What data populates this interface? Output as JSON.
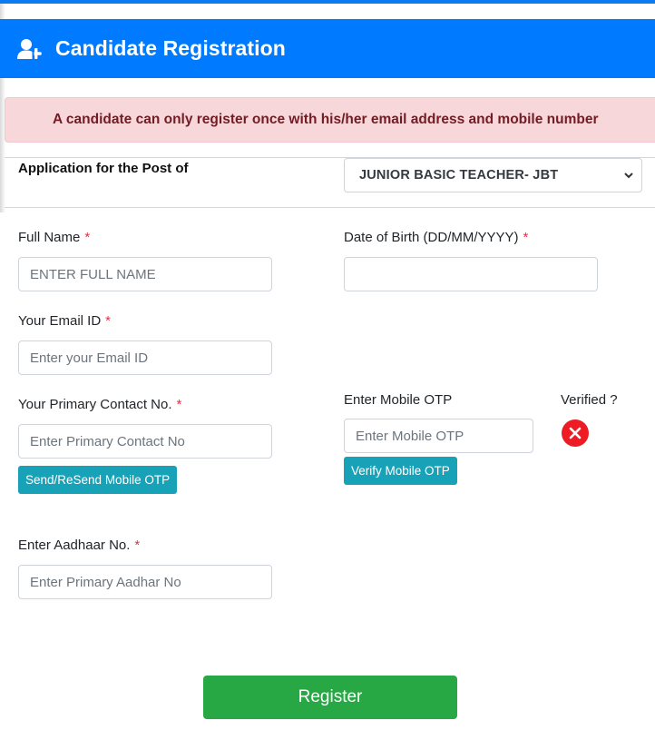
{
  "header": {
    "title": "Candidate Registration",
    "icon": "user-plus-icon",
    "color": "#007bff"
  },
  "alert": {
    "message": "A candidate can only register once with his/her email address and mobile number",
    "bg_color": "#f8d7da",
    "text_color": "#721c24"
  },
  "post": {
    "label": "Application for the Post of",
    "selected": "JUNIOR BASIC TEACHER- JBT"
  },
  "fields": {
    "full_name": {
      "label": "Full Name",
      "required": "*",
      "placeholder": "ENTER FULL NAME",
      "value": ""
    },
    "dob": {
      "label": "Date of Birth (DD/MM/YYYY)",
      "required": "*",
      "placeholder": "",
      "value": ""
    },
    "email": {
      "label": "Your Email ID",
      "required": "*",
      "placeholder": "Enter your Email ID",
      "value": ""
    },
    "contact": {
      "label": "Your Primary Contact No.",
      "required": "*",
      "placeholder": "Enter Primary Contact No",
      "value": ""
    },
    "mobile_otp": {
      "label": "Enter Mobile OTP",
      "placeholder": "Enter Mobile OTP",
      "value": ""
    },
    "aadhaar": {
      "label": "Enter Aadhaar No.",
      "required": "*",
      "placeholder": "Enter Primary Aadhar No",
      "value": ""
    }
  },
  "verified": {
    "label": "Verified ?",
    "status": "not-verified",
    "icon": "close-circle-icon",
    "color": "#ed1c24"
  },
  "buttons": {
    "send_otp": "Send/ReSend Mobile OTP",
    "verify_otp": "Verify Mobile OTP",
    "register": "Register"
  }
}
